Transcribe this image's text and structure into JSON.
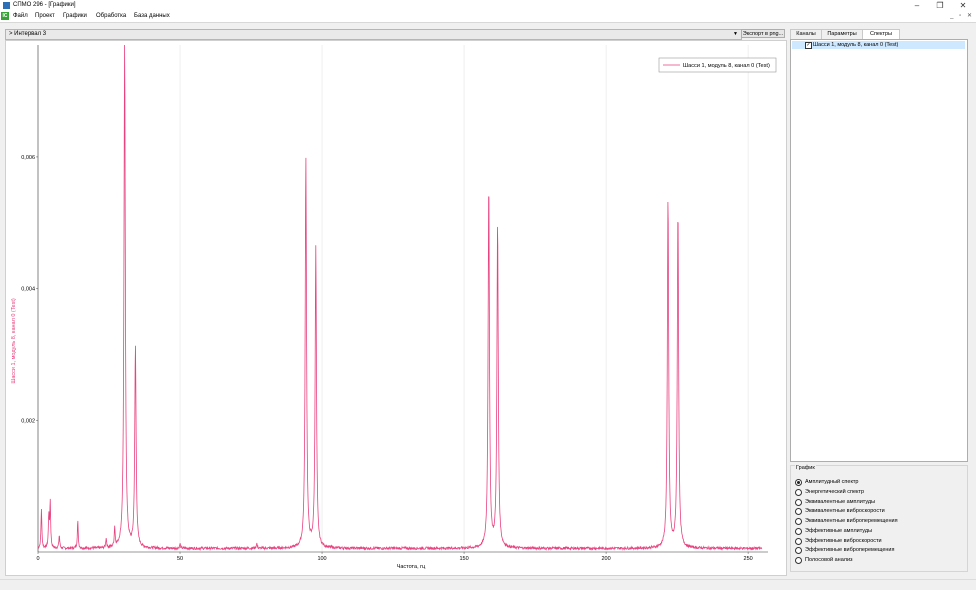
{
  "window": {
    "title": "СПМО 296 - [Графики]",
    "controls": {
      "minimize": "–",
      "maximize": "❐",
      "close": "✕"
    }
  },
  "menu": {
    "logo": "IC",
    "items": [
      "Файл",
      "Проект",
      "Графики",
      "Обработка",
      "База данных"
    ],
    "mdi_controls": "_ ▫ ✕"
  },
  "toolbar": {
    "interval_value": "> Интервал 3",
    "export_label": "Экспорт в png..."
  },
  "tabs": [
    {
      "label": "Каналы",
      "active": false
    },
    {
      "label": "Параметры",
      "active": false
    },
    {
      "label": "Спектры",
      "active": true
    }
  ],
  "spectra_list": [
    {
      "label": "Шасси 1, модуль 8, канал 0 (Test)",
      "checked": true
    }
  ],
  "graph_group": {
    "title": "График",
    "options": [
      {
        "label": "Амплитудный спектр",
        "selected": true
      },
      {
        "label": "Энергетический спектр",
        "selected": false
      },
      {
        "label": "Эквивалентные амплитуды",
        "selected": false
      },
      {
        "label": "Эквивалентные виброскорости",
        "selected": false
      },
      {
        "label": "Эквивалентные виброперемещения",
        "selected": false
      },
      {
        "label": "Эффективные амплитуды",
        "selected": false
      },
      {
        "label": "Эффективные виброскорости",
        "selected": false
      },
      {
        "label": "Эффективные виброперемещения",
        "selected": false
      },
      {
        "label": "Полосовой анализ",
        "selected": false
      }
    ]
  },
  "colors": {
    "series": "#e8437f",
    "ylabel": "#e8437f",
    "grid": "#e4e4e4"
  },
  "chart_data": {
    "type": "line",
    "xlabel": "Частота, гц",
    "ylabel": "Шасси 1, модуль 8, канал 0 (Test)",
    "xlim": [
      0,
      257
    ],
    "ylim": [
      0,
      0.0077
    ],
    "xticks": [
      0,
      50,
      100,
      150,
      200,
      250
    ],
    "xtick_labels": [
      "0",
      "50",
      "100",
      "150",
      "200",
      "250"
    ],
    "yticks": [
      0.002,
      0.004,
      0.006
    ],
    "ytick_labels": [
      "0,002",
      "0,004",
      "0,006"
    ],
    "grid": "vertical",
    "legend": "top-right",
    "series": [
      {
        "name": "Шасси 1, модуль 8, канал 0 (Test)",
        "peaks": [
          {
            "x": 1.2,
            "y": 0.0006
          },
          {
            "x": 3.8,
            "y": 0.0005
          },
          {
            "x": 4.3,
            "y": 0.0007
          },
          {
            "x": 7.5,
            "y": 0.0002
          },
          {
            "x": 14,
            "y": 0.00042
          },
          {
            "x": 24,
            "y": 0.00015
          },
          {
            "x": 27,
            "y": 0.0003
          },
          {
            "x": 30.5,
            "y": 0.0077
          },
          {
            "x": 34.3,
            "y": 0.00305
          },
          {
            "x": 50,
            "y": 7e-05
          },
          {
            "x": 77,
            "y": 8e-05
          },
          {
            "x": 94.3,
            "y": 0.00595
          },
          {
            "x": 97.8,
            "y": 0.00455
          },
          {
            "x": 158.7,
            "y": 0.00555
          },
          {
            "x": 161.8,
            "y": 0.00492
          },
          {
            "x": 221.8,
            "y": 0.00532
          },
          {
            "x": 225.3,
            "y": 0.00515
          }
        ]
      }
    ]
  }
}
